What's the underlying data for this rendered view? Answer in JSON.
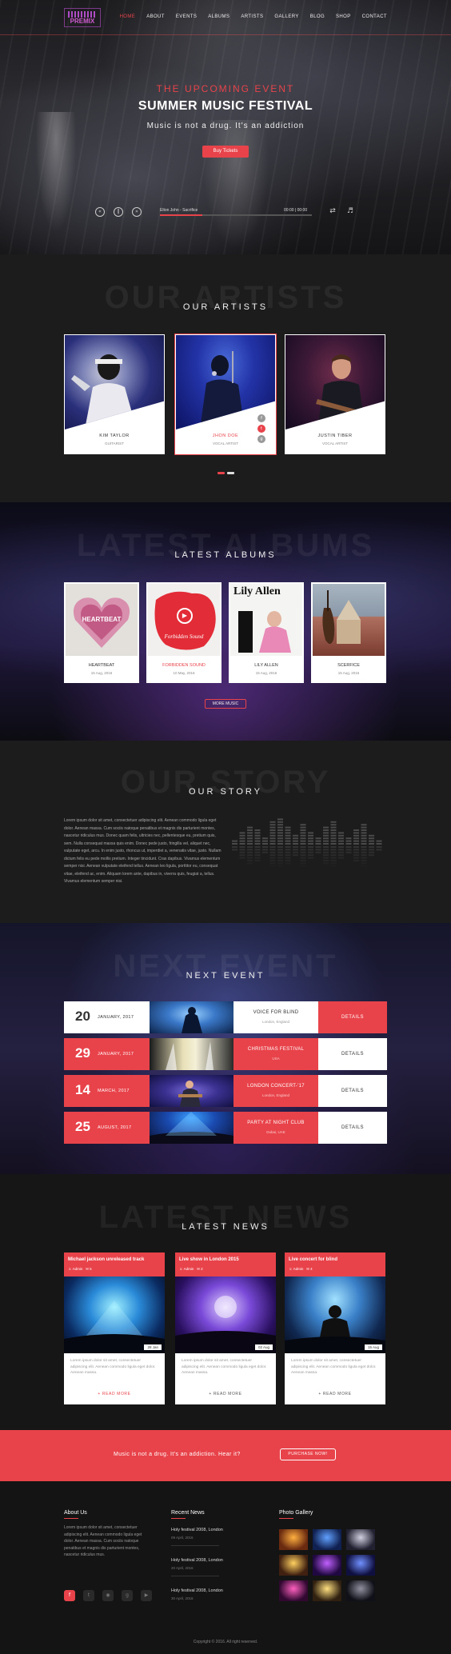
{
  "nav": {
    "logo_text": "PREMIX",
    "menu": [
      "HOME",
      "ABOUT",
      "EVENTS",
      "ALBUMS",
      "ARTISTS",
      "GALLERY",
      "BLOG",
      "SHOP",
      "CONTACT"
    ],
    "active": "HOME"
  },
  "hero": {
    "eyebrow": "THE UPCOMING EVENT",
    "title": "SUMMER MUSIC FESTIVAL",
    "subtitle": "Music is not a drug. It's an addiction",
    "button": "Buy Tickets",
    "player": {
      "track": "Elton John - Sacrifice",
      "time": "00:00 | 00:00",
      "progress_pct": 28
    }
  },
  "artists": {
    "ghost": "OUR ARTISTS",
    "title": "OUR ARTISTS",
    "items": [
      {
        "name": "KIM TAYLOR",
        "role": "GUITARIST"
      },
      {
        "name": "JHON DOE",
        "role": "VOCAL ARTIST"
      },
      {
        "name": "JUSTIN TIBER",
        "role": "VOCAL ARTIST"
      }
    ]
  },
  "albums": {
    "ghost": "LATEST ALBUMS",
    "title": "LATEST ALBUMS",
    "items": [
      {
        "name": "HEARTBEAT",
        "date": "15 Aug, 2016",
        "cover_text": "HEARTBEAT"
      },
      {
        "name": "FORBIDDEN SOUND",
        "date": "10 May, 2016",
        "cover_text": "Forbidden Sound"
      },
      {
        "name": "LILY ALLEN",
        "date": "15 Aug, 2016",
        "cover_text": "Lily Allen"
      },
      {
        "name": "SCERFICE",
        "date": "15 Aug, 2016",
        "cover_text": ""
      }
    ],
    "more_button": "MORE MUSIC"
  },
  "story": {
    "ghost": "OUR STORY",
    "title": "OUR STORY",
    "text": "Lorem ipsum dolor sit amet, consectetuer adipiscing elit. Aenean commodo ligula eget dolor. Aenean massa. Cum sociis natoque penatibus et magnis dis parturient montes, nascetur ridiculus mus. Donec quam felis, ultricies nec, pellentesque eu, pretium quis, sem. Nulla consequat massa quis enim. Donec pede justo, fringilla vel, aliquet nec, vulputate eget, arcu. In enim justo, rhoncus ut, imperdiet a, venenatis vitae, justo. Nullam dictum felis eu pede mollis pretium. Integer tincidunt. Cras dapibus. Vivamus elementum semper nisi. Aenean vulputate eleifend tellus. Aenean leo ligula, porttitor eu, consequat vitae, eleifend ac, enim. Aliquam lorem ante, dapibus in, viverra quis, feugiat a, tellus. Vivamus elementum semper nisi."
  },
  "events": {
    "ghost": "NEXT EVENT",
    "title": "NEXT EVENT",
    "items": [
      {
        "day": "20",
        "month": "JANUARY, 2017",
        "name": "VOICE FOR BLIND",
        "location": "London, England",
        "button": "DETAILS"
      },
      {
        "day": "29",
        "month": "JANUARY, 2017",
        "name": "CHRISTMAS FESTIVAL",
        "location": "USA",
        "button": "DETAILS"
      },
      {
        "day": "14",
        "month": "MARCH, 2017",
        "name": "LONDON CONCERT-'17",
        "location": "London, England",
        "button": "DETAILS"
      },
      {
        "day": "25",
        "month": "AUGUST, 2017",
        "name": "PARTY AT NIGHT CLUB",
        "location": "Dubai, UAE",
        "button": "DETAILS"
      }
    ]
  },
  "news": {
    "ghost": "LATEST NEWS",
    "title": "LATEST NEWS",
    "items": [
      {
        "title": "Michael jackson unreleased track",
        "author": "Admin",
        "comments": "5",
        "date": "28 Jan",
        "excerpt": "Lorem ipsum dolor sit amet, consectetuer adipiscing elit. Aenean commodo ligula eget dolor. Aenean massa.",
        "more": "+ READ MORE"
      },
      {
        "title": "Live show in London 2015",
        "author": "Admin",
        "comments": "2",
        "date": "02 Aug",
        "excerpt": "Lorem ipsum dolor sit amet, consectetuer adipiscing elit. Aenean commodo ligula eget dolor. Aenean massa.",
        "more": "+ READ MORE"
      },
      {
        "title": "Live concert for blind",
        "author": "Admin",
        "comments": "4",
        "date": "15 Aug",
        "excerpt": "Lorem ipsum dolor sit amet, consectetuer adipiscing elit. Aenean commodo ligula eget dolor. Aenean massa.",
        "more": "+ READ MORE"
      }
    ]
  },
  "cta": {
    "text": "Music is not a drug. It's an addiction. Hear it?",
    "button": "PURCHASE NOW!"
  },
  "footer": {
    "about_title": "About Us",
    "about_text": "Lorem ipsum dolor sit amet, consectetuer adipiscing elit. Aenean commodo ligula eget dolor. Aenean massa. Cum sociis natoque penatibus et magnis dis parturient montes, nascetur ridiculus mus.",
    "news_title": "Recent News",
    "news": [
      {
        "title": "Holy festival 2008, London",
        "date": "09 April, 2016"
      },
      {
        "title": "Holy festival 2008, London",
        "date": "20 April, 2016"
      },
      {
        "title": "Holy festival 2008, London",
        "date": "30 April, 2016"
      }
    ],
    "gallery_title": "Photo Gallery",
    "copyright": "Copyright © 2016. All right reserved."
  },
  "colors": {
    "accent": "#e8434a",
    "background": "#161616"
  }
}
